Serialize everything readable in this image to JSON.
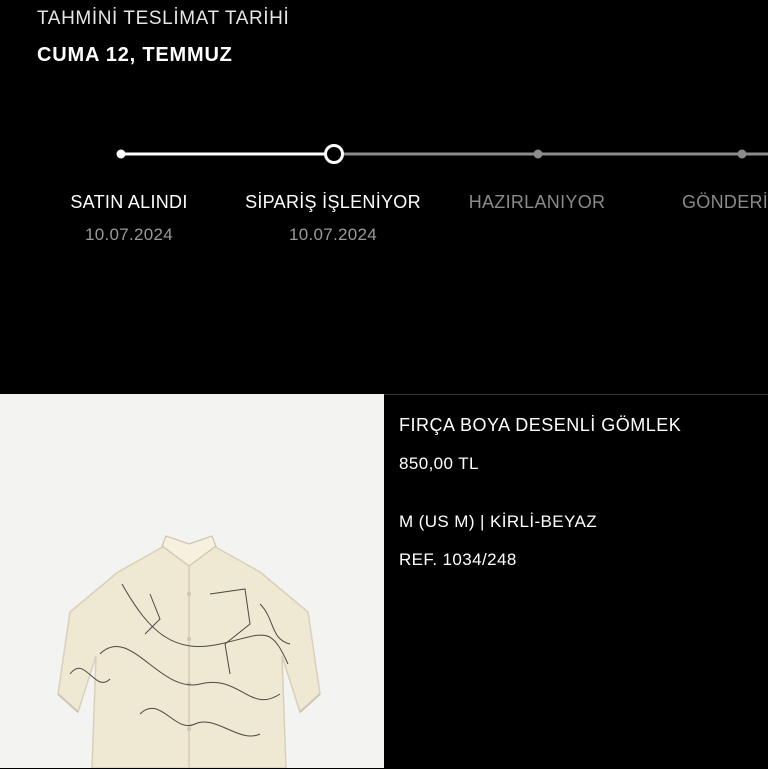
{
  "delivery": {
    "label": "TAHMİNİ TESLİMAT TARİHİ",
    "date": "CUMA 12, TEMMUZ"
  },
  "tracker": {
    "stages": [
      {
        "label": "SATIN ALINDI",
        "date": "10.07.2024",
        "status": "done"
      },
      {
        "label": "SİPARİŞ İŞLENİYOR",
        "date": "10.07.2024",
        "status": "current"
      },
      {
        "label": "HAZIRLANIYOR",
        "date": "",
        "status": "pending"
      },
      {
        "label": "GÖNDERİ",
        "date": "",
        "status": "pending"
      }
    ],
    "colors": {
      "active": "#ffffff",
      "inactive": "#8c8c8c"
    }
  },
  "product": {
    "name": "FIRÇA BOYA DESENLİ GÖMLEK",
    "price": "850,00 TL",
    "variant": "M (US M) | KİRLİ-BEYAZ",
    "ref": "REF. 1034/248",
    "image_alt": "shirt-image"
  }
}
